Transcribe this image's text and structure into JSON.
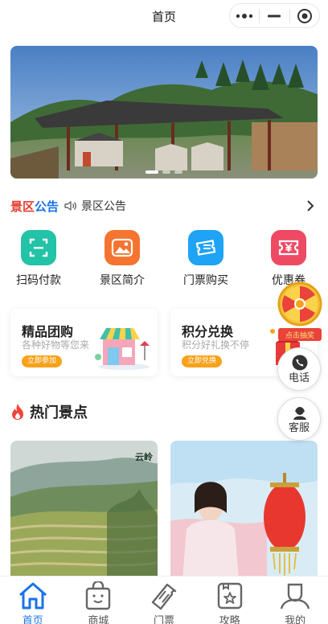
{
  "header": {
    "title": "首页"
  },
  "notice": {
    "brand_part1": "景区",
    "brand_part2": "公告",
    "text": "景区公告"
  },
  "menu": [
    {
      "label": "扫码付款",
      "icon": "scan-icon",
      "color": "#22c3a6"
    },
    {
      "label": "景区简介",
      "icon": "picture-icon",
      "color": "#f5742f"
    },
    {
      "label": "门票购买",
      "icon": "ticket-icon",
      "color": "#1ea3f5"
    },
    {
      "label": "优惠券",
      "icon": "coupon-icon",
      "color": "#ee4a63"
    }
  ],
  "promos": [
    {
      "title": "精品团购",
      "subtitle": "各种好物等您来",
      "button": "立即参加"
    },
    {
      "title": "积分兑换",
      "subtitle": "积分好礼换不停",
      "button": "立即兑换"
    }
  ],
  "section": {
    "title": "热门景点"
  },
  "floating": {
    "lottery_label": "点击抽奖",
    "phone": "电话",
    "service": "客服"
  },
  "spots": [
    {
      "watermark": "云岭"
    }
  ],
  "tabs": [
    {
      "label": "首页",
      "icon": "home-icon",
      "active": true
    },
    {
      "label": "商城",
      "icon": "shopping-bag-icon",
      "active": false
    },
    {
      "label": "门票",
      "icon": "ticket-icon",
      "active": false
    },
    {
      "label": "攻略",
      "icon": "guide-icon",
      "active": false
    },
    {
      "label": "我的",
      "icon": "user-icon",
      "active": false
    }
  ],
  "colors": {
    "accent": "#1a73e8",
    "notice_red": "#e63b2e",
    "button_orange": "#f7a21b"
  }
}
